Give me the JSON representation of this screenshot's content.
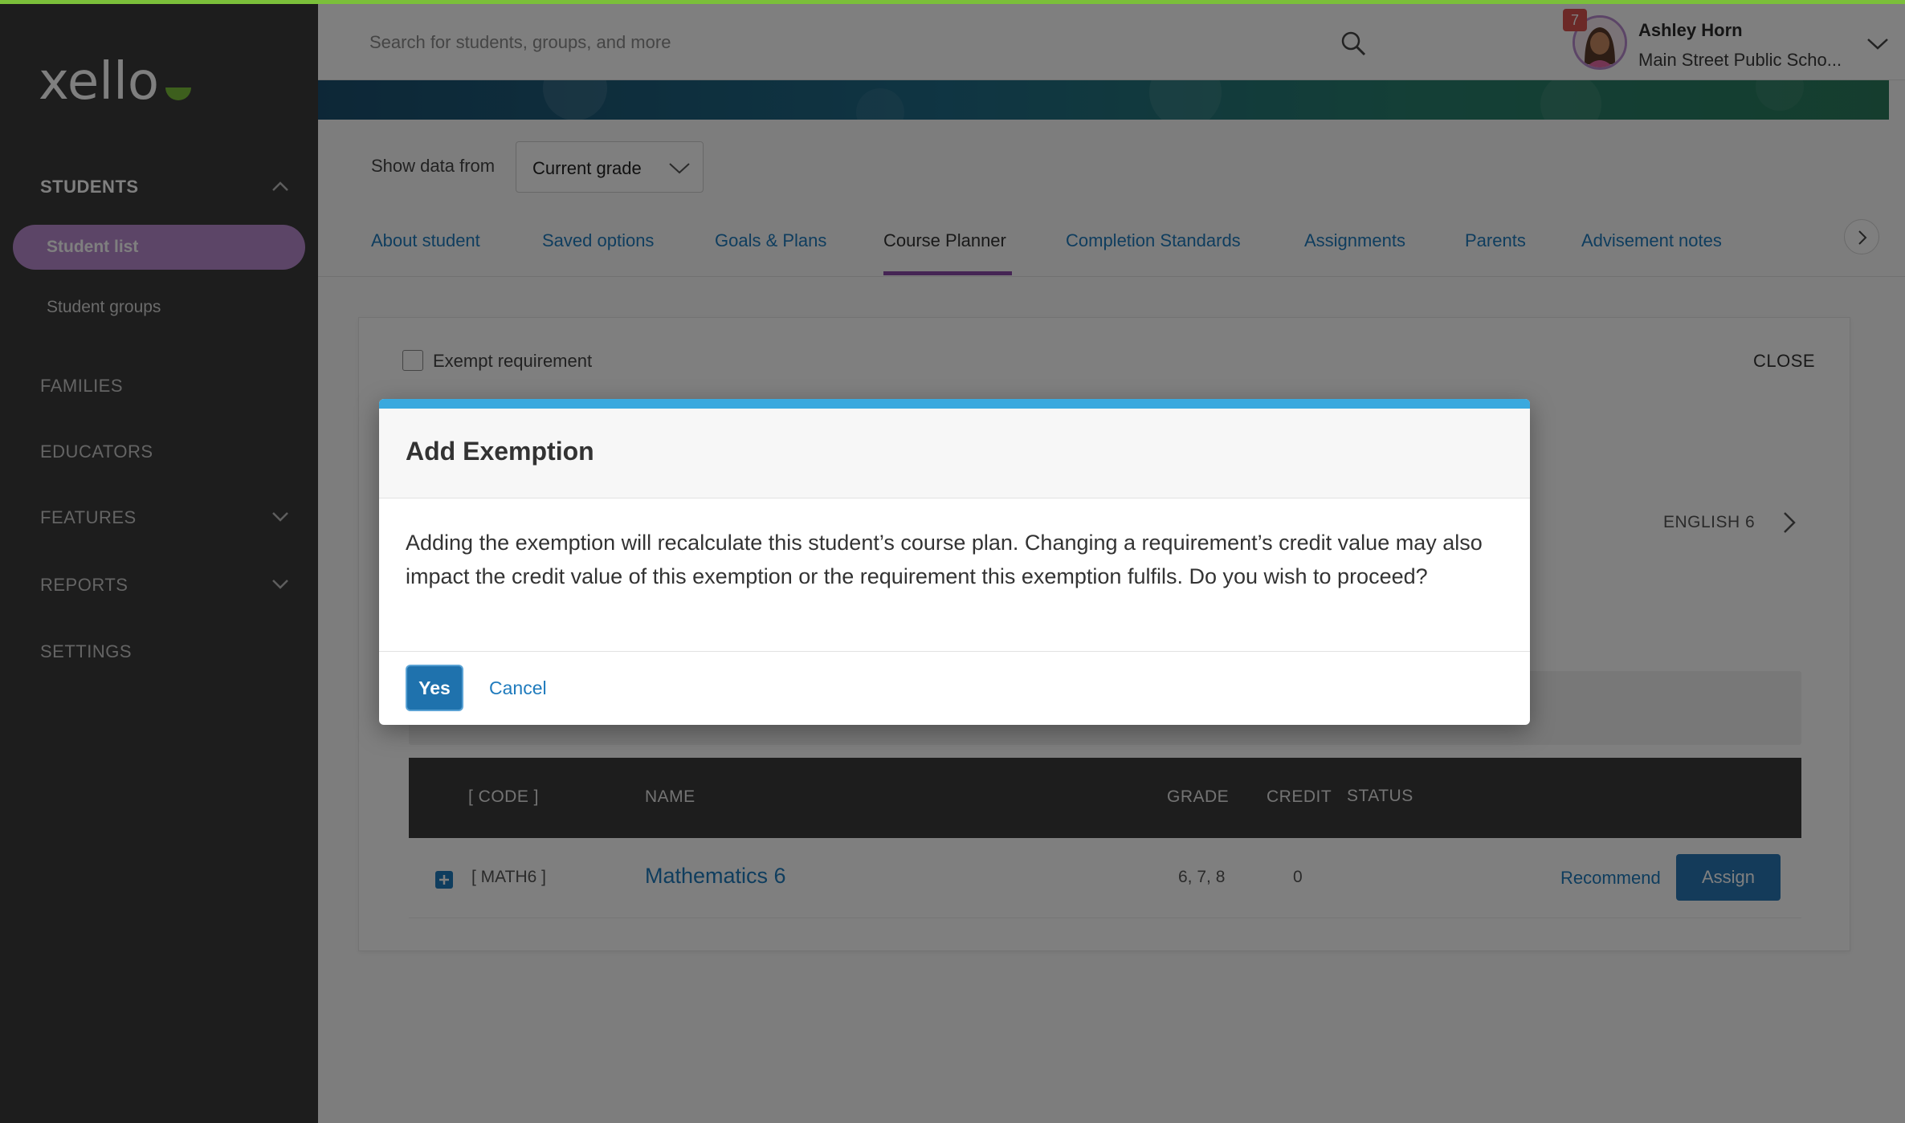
{
  "app": {
    "logo_text": "xello"
  },
  "sidebar": {
    "sections": [
      {
        "label": "STUDENTS",
        "expanded": true
      },
      {
        "label": "FAMILIES"
      },
      {
        "label": "EDUCATORS"
      },
      {
        "label": "FEATURES",
        "expanded": false
      },
      {
        "label": "REPORTS",
        "expanded": false
      },
      {
        "label": "SETTINGS"
      }
    ],
    "students_items": [
      {
        "label": "Student list",
        "active": true
      },
      {
        "label": "Student groups"
      }
    ]
  },
  "header": {
    "search_placeholder": "Search for students, groups, and more",
    "notification_count": "7",
    "user_name": "Ashley Horn",
    "user_school": "Main Street Public Scho..."
  },
  "filters": {
    "show_label": "Show data from",
    "grade_value": "Current grade"
  },
  "tabs": [
    {
      "label": "About student"
    },
    {
      "label": "Saved options"
    },
    {
      "label": "Goals & Plans"
    },
    {
      "label": "Course Planner",
      "active": true
    },
    {
      "label": "Completion Standards"
    },
    {
      "label": "Assignments"
    },
    {
      "label": "Parents"
    },
    {
      "label": "Advisement notes"
    }
  ],
  "panel": {
    "exempt_label": "Exempt requirement",
    "close_label": "CLOSE",
    "requirement_label": "ENGLISH 6",
    "columns": {
      "code": "[  CODE  ]",
      "name": "NAME",
      "grade": "GRADE",
      "credit": "CREDIT",
      "status": "STATUS"
    },
    "rows": [
      {
        "code": "[ MATH6 ]",
        "name": "Mathematics 6",
        "grade": "6, 7, 8",
        "credit": "0",
        "recommend": "Recommend",
        "assign": "Assign"
      }
    ]
  },
  "modal": {
    "title": "Add Exemption",
    "body": "Adding the exemption will recalculate this student’s course plan. Changing a requirement’s credit value may also impact the credit value of this exemption or the requirement this exemption fulfils. Do you wish to proceed?",
    "yes_label": "Yes",
    "cancel_label": "Cancel"
  },
  "colors": {
    "sidebar_bg": "#3a3a3a",
    "active_nav": "#b98bcf",
    "link": "#1f7bbd",
    "primary_button": "#2876b5",
    "modal_accent": "#3aa9de",
    "tab_underline": "#8a4aa8"
  },
  "icons": [
    "search-icon",
    "chevron-up-icon",
    "chevron-down-icon",
    "chevron-right-icon",
    "plus-square-icon",
    "avatar"
  ]
}
